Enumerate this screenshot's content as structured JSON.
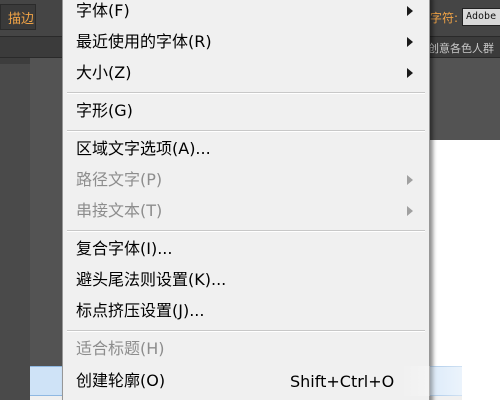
{
  "app": {
    "toolbar_left_text": "描边",
    "toolbar_right_label": "字符:",
    "font_field_value": "Adobe",
    "doc_tab_text": "创意各色人群"
  },
  "menu": {
    "items": [
      {
        "label": "字体(F)",
        "has_submenu": true,
        "disabled": false
      },
      {
        "label": "最近使用的字体(R)",
        "has_submenu": true,
        "disabled": false
      },
      {
        "label": "大小(Z)",
        "has_submenu": true,
        "disabled": false
      },
      {
        "label": "字形(G)",
        "has_submenu": false,
        "disabled": false
      },
      {
        "label": "区域文字选项(A)...",
        "has_submenu": false,
        "disabled": false
      },
      {
        "label": "路径文字(P)",
        "has_submenu": true,
        "disabled": true
      },
      {
        "label": "串接文本(T)",
        "has_submenu": true,
        "disabled": true
      },
      {
        "label": "复合字体(I)...",
        "has_submenu": false,
        "disabled": false
      },
      {
        "label": "避头尾法则设置(K)...",
        "has_submenu": false,
        "disabled": false
      },
      {
        "label": "标点挤压设置(J)...",
        "has_submenu": false,
        "disabled": false
      },
      {
        "label": "适合标题(H)",
        "has_submenu": false,
        "disabled": true
      },
      {
        "label": "创建轮廓(O)",
        "has_submenu": false,
        "disabled": false,
        "highlighted": true,
        "shortcut": "Shift+Ctrl+O"
      }
    ]
  },
  "colors": {
    "highlight": "#cfe3f7",
    "toolbar_accent": "#f0a346",
    "disabled_text": "#8d8d8d"
  }
}
